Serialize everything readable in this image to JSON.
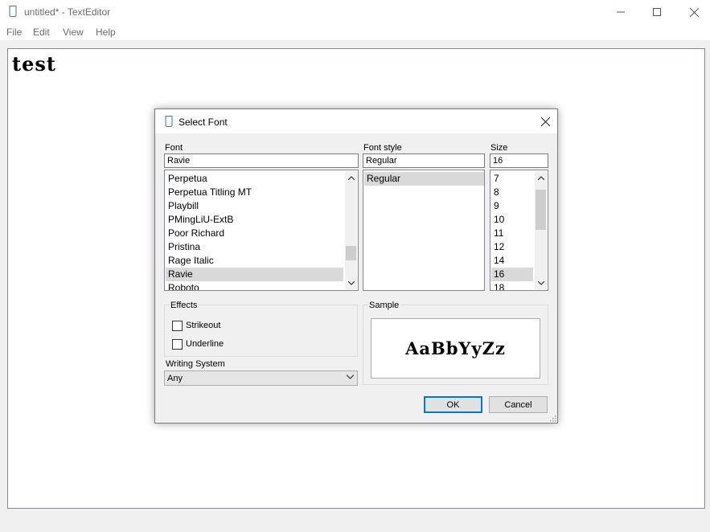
{
  "window": {
    "title": "untitled* - TextEditor"
  },
  "menu": [
    {
      "label": "File"
    },
    {
      "label": "Edit"
    },
    {
      "label": "View"
    },
    {
      "label": "Help"
    }
  ],
  "editor": {
    "content": "test"
  },
  "dialog": {
    "title": "Select Font",
    "font": {
      "label": "Font",
      "value": "Ravie",
      "items": [
        "Perpetua",
        "Perpetua Titling MT",
        "Playbill",
        "PMingLiU-ExtB",
        "Poor Richard",
        "Pristina",
        "Rage Italic",
        "Ravie",
        "Roboto"
      ],
      "selected": "Ravie"
    },
    "style": {
      "label": "Font style",
      "value": "Regular",
      "items": [
        "Regular"
      ],
      "selected": "Regular"
    },
    "size": {
      "label": "Size",
      "value": "16",
      "items": [
        "7",
        "8",
        "9",
        "10",
        "11",
        "12",
        "14",
        "16",
        "18"
      ],
      "selected": "16"
    },
    "effects": {
      "label": "Effects",
      "strikeout": {
        "label": "Strikeout",
        "checked": false
      },
      "underline": {
        "label": "Underline",
        "checked": false
      }
    },
    "writing_system": {
      "label": "Writing System",
      "value": "Any"
    },
    "sample": {
      "label": "Sample",
      "text": "AaBbYyZz"
    },
    "buttons": {
      "ok": "OK",
      "cancel": "Cancel"
    }
  },
  "icons": {
    "app": "document-icon",
    "minimize": "minimize-icon",
    "maximize": "maximize-icon",
    "close": "close-icon"
  },
  "colors": {
    "accent": "#0078d7",
    "selection": "#d9d9d9"
  }
}
